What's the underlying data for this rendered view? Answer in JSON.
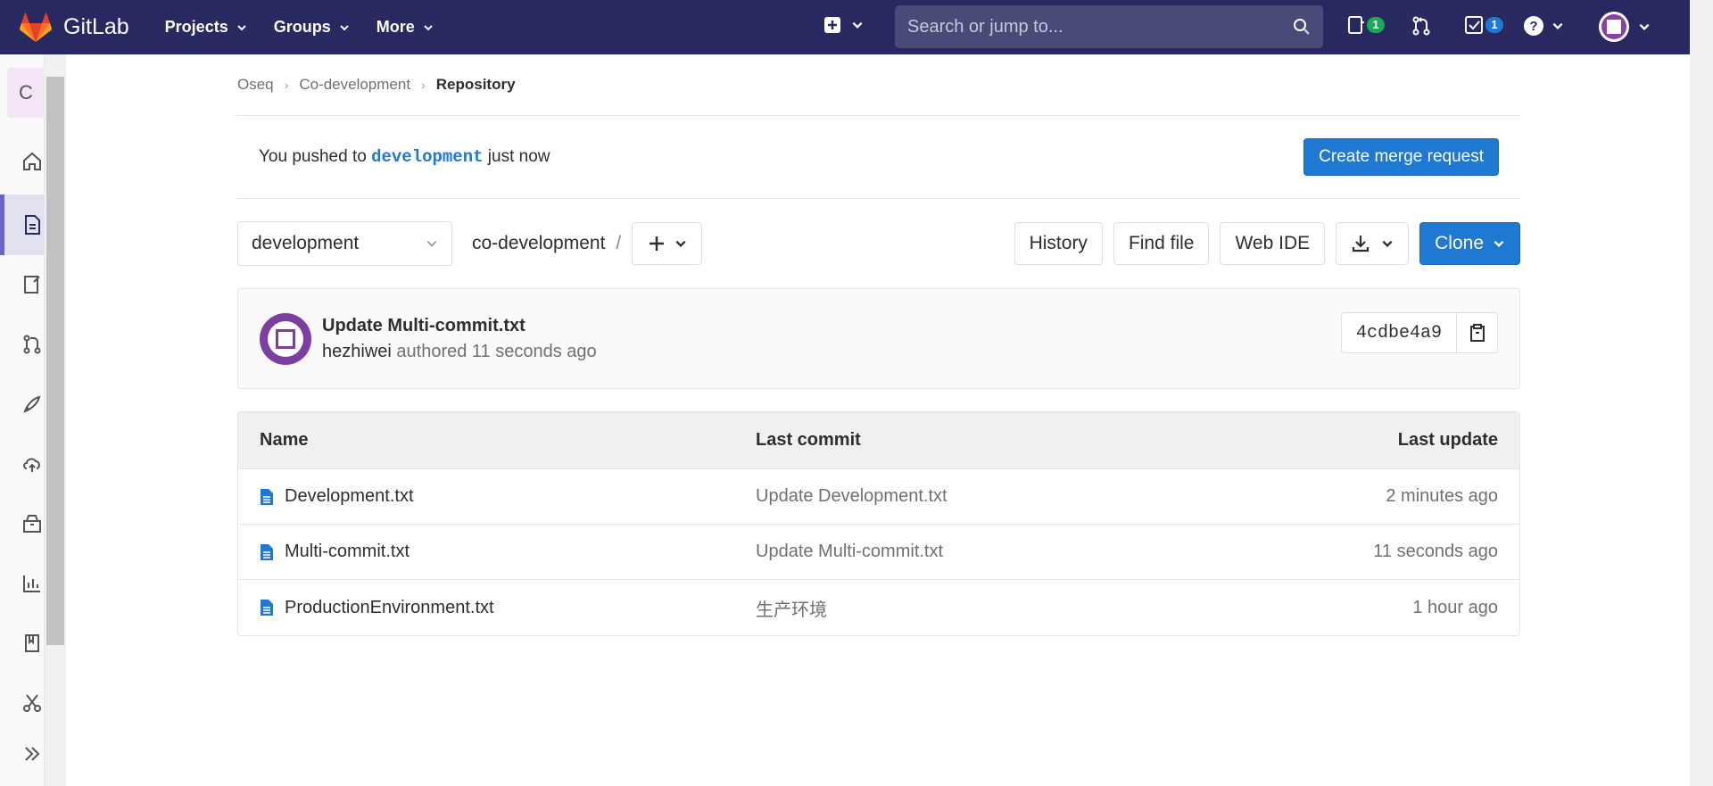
{
  "navbar": {
    "brand": "GitLab",
    "menu": [
      {
        "label": "Projects"
      },
      {
        "label": "Groups"
      },
      {
        "label": "More"
      }
    ],
    "search_placeholder": "Search or jump to...",
    "issues_count": "1",
    "todos_count": "1"
  },
  "sidebar": {
    "project_initial": "C"
  },
  "breadcrumb": {
    "group": "Oseq",
    "project": "Co-development",
    "current": "Repository"
  },
  "alert": {
    "prefix": "You pushed to",
    "branch": "development",
    "suffix": "just now",
    "button": "Create merge request"
  },
  "toolbar": {
    "branch": "development",
    "path": "co-development",
    "path_sep": "/",
    "history": "History",
    "find_file": "Find file",
    "web_ide": "Web IDE",
    "clone": "Clone"
  },
  "commit": {
    "title": "Update Multi-commit.txt",
    "author": "hezhiwei",
    "authored": "authored",
    "time": "11 seconds ago",
    "sha": "4cdbe4a9"
  },
  "table": {
    "headers": {
      "name": "Name",
      "commit": "Last commit",
      "date": "Last update"
    },
    "rows": [
      {
        "name": "Development.txt",
        "commit": "Update Development.txt",
        "date": "2 minutes ago"
      },
      {
        "name": "Multi-commit.txt",
        "commit": "Update Multi-commit.txt",
        "date": "11 seconds ago"
      },
      {
        "name": "ProductionEnvironment.txt",
        "commit": "生产环境",
        "date": "1 hour ago"
      }
    ]
  },
  "colors": {
    "navbar": "#292961",
    "primary": "#1f78d1",
    "sidebar_active": "#6666c4"
  }
}
